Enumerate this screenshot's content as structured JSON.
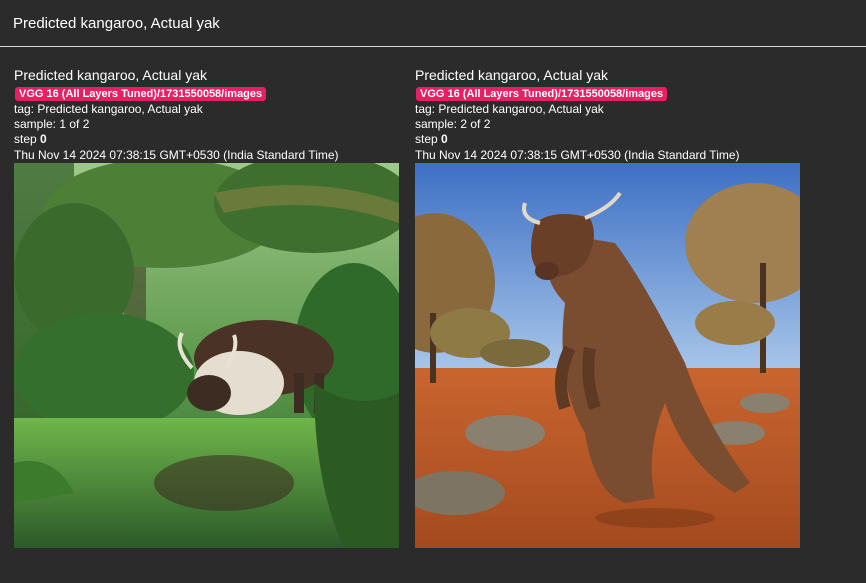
{
  "header": {
    "title": "Predicted kangaroo, Actual yak"
  },
  "cards": [
    {
      "title": "Predicted kangaroo, Actual yak",
      "run": "VGG 16 (All Layers Tuned)/1731550058/images",
      "tag_label": "tag: ",
      "tag": "Predicted kangaroo, Actual yak",
      "sample_label": "sample: ",
      "sample": "1 of 2",
      "step_label": "step ",
      "step": "0",
      "timestamp": "Thu Nov 14 2024 07:38:15 GMT+0530 (India Standard Time)",
      "image": "yak drinking from jungle river"
    },
    {
      "title": "Predicted kangaroo, Actual yak",
      "run": "VGG 16 (All Layers Tuned)/1731550058/images",
      "tag_label": "tag: ",
      "tag": "Predicted kangaroo, Actual yak",
      "sample_label": "sample: ",
      "sample": "2 of 2",
      "step_label": "step ",
      "step": "0",
      "timestamp": "Thu Nov 14 2024 07:38:15 GMT+0530 (India Standard Time)",
      "image": "yak standing upright in outback"
    }
  ],
  "colors": {
    "background": "#2b2b2b",
    "badge": "#e91e63",
    "divider": "#d9d9d9"
  }
}
